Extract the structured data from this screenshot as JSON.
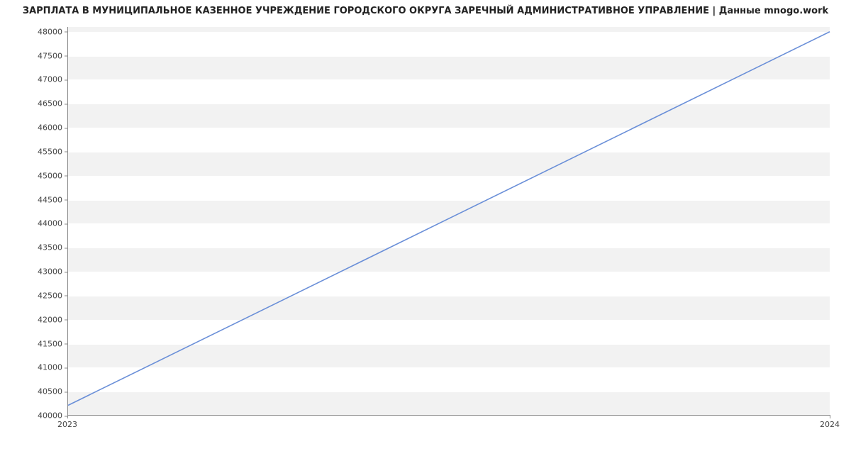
{
  "chart_data": {
    "type": "line",
    "title": "ЗАРПЛАТА В МУНИЦИПАЛЬНОЕ КАЗЕННОЕ УЧРЕЖДЕНИЕ ГОРОДСКОГО ОКРУГА ЗАРЕЧНЫЙ АДМИНИСТРАТИВНОЕ УПРАВЛЕНИЕ | Данные mnogo.work",
    "x": [
      2023,
      2024
    ],
    "values": [
      40200,
      48000
    ],
    "xlabel": "",
    "ylabel": "",
    "ylim": [
      40000,
      48100
    ],
    "y_ticks": [
      40000,
      40500,
      41000,
      41500,
      42000,
      42500,
      43000,
      43500,
      44000,
      44500,
      45000,
      45500,
      46000,
      46500,
      47000,
      47500,
      48000
    ],
    "x_ticks": [
      2023,
      2024
    ],
    "line_color": "#6a8fd8",
    "grid": true
  }
}
